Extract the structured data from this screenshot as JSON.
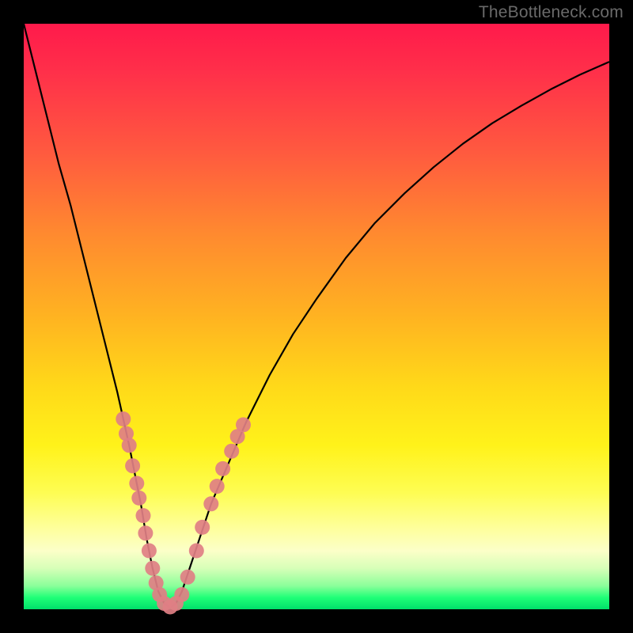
{
  "watermark": "TheBottleneck.com",
  "chart_data": {
    "type": "line",
    "title": "",
    "xlabel": "",
    "ylabel": "",
    "xlim": [
      0,
      100
    ],
    "ylim": [
      0,
      100
    ],
    "series": [
      {
        "name": "bottleneck-curve",
        "x": [
          0,
          2,
          4,
          6,
          8,
          10,
          12,
          14,
          16,
          18,
          20,
          21,
          22,
          23,
          24,
          25,
          26,
          27,
          28,
          30,
          32,
          35,
          38,
          42,
          46,
          50,
          55,
          60,
          65,
          70,
          75,
          80,
          85,
          90,
          95,
          100
        ],
        "values": [
          100,
          92,
          84,
          76,
          69,
          61,
          53,
          45,
          37,
          28,
          18,
          12,
          7,
          3,
          1,
          0.3,
          1,
          3,
          6,
          12,
          18,
          25,
          32,
          40,
          47,
          53,
          60,
          66,
          71,
          75.5,
          79.5,
          83,
          86,
          88.8,
          91.3,
          93.5
        ]
      }
    ],
    "markers": {
      "name": "highlighted-samples",
      "color": "#e07f84",
      "points": [
        {
          "x": 17.0,
          "y": 32.5
        },
        {
          "x": 17.5,
          "y": 30.0
        },
        {
          "x": 18.0,
          "y": 28.0
        },
        {
          "x": 18.6,
          "y": 24.5
        },
        {
          "x": 19.3,
          "y": 21.5
        },
        {
          "x": 19.7,
          "y": 19.0
        },
        {
          "x": 20.4,
          "y": 16.0
        },
        {
          "x": 20.8,
          "y": 13.0
        },
        {
          "x": 21.4,
          "y": 10.0
        },
        {
          "x": 22.0,
          "y": 7.0
        },
        {
          "x": 22.6,
          "y": 4.5
        },
        {
          "x": 23.2,
          "y": 2.5
        },
        {
          "x": 24.0,
          "y": 1.0
        },
        {
          "x": 25.0,
          "y": 0.4
        },
        {
          "x": 26.0,
          "y": 1.0
        },
        {
          "x": 27.0,
          "y": 2.5
        },
        {
          "x": 28.0,
          "y": 5.5
        },
        {
          "x": 29.5,
          "y": 10.0
        },
        {
          "x": 30.5,
          "y": 14.0
        },
        {
          "x": 32.0,
          "y": 18.0
        },
        {
          "x": 33.0,
          "y": 21.0
        },
        {
          "x": 34.0,
          "y": 24.0
        },
        {
          "x": 35.5,
          "y": 27.0
        },
        {
          "x": 36.5,
          "y": 29.5
        },
        {
          "x": 37.5,
          "y": 31.5
        }
      ]
    }
  }
}
